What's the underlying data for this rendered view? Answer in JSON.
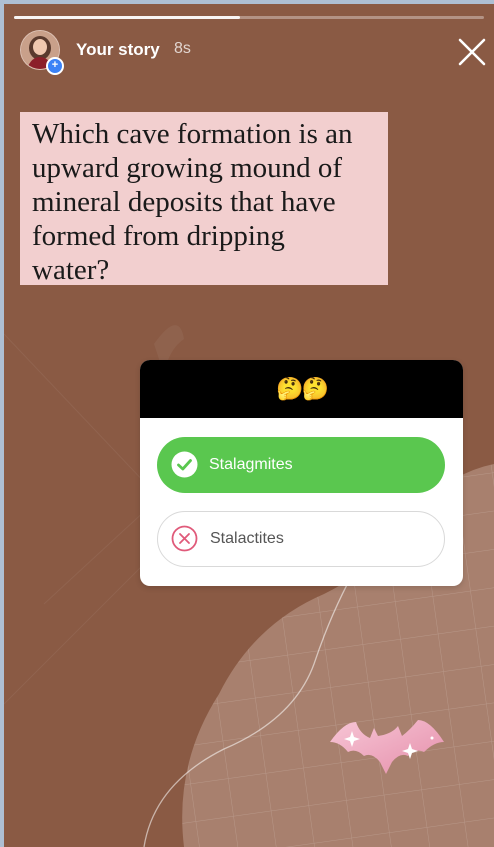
{
  "story": {
    "title": "Your story",
    "time": "8s",
    "progress_fraction": 0.48
  },
  "question": {
    "lines": [
      "Which cave formation is an",
      "upward growing mound of",
      "mineral deposits that have",
      "formed from dripping",
      "water?"
    ]
  },
  "quiz": {
    "header_emoji": "🤔🤔",
    "options": [
      {
        "label": "Stalagmites",
        "state": "correct",
        "icon": "check-circle-icon"
      },
      {
        "label": "Stalactites",
        "state": "incorrect",
        "icon": "x-circle-icon"
      }
    ]
  },
  "colors": {
    "background": "#8a5a44",
    "question_box": "#f2cfcf",
    "correct": "#5ac74f",
    "incorrect": "#e05a7a"
  }
}
